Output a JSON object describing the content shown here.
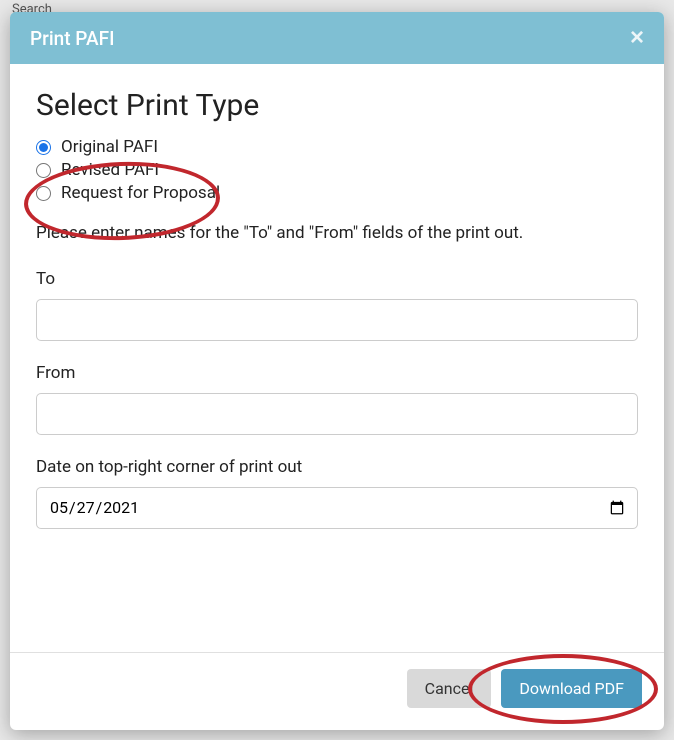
{
  "background": {
    "search_placeholder": "Search"
  },
  "modal": {
    "title": "Print PAFI",
    "section_title": "Select Print Type",
    "radios": {
      "original": "Original PAFI",
      "revised": "Revised PAFI",
      "rfp": "Request for Proposal"
    },
    "instruction": "Please enter names for the \"To\" and \"From\" fields of the print out.",
    "to_label": "To",
    "to_value": "",
    "from_label": "From",
    "from_value": "",
    "date_label": "Date on top-right corner of print out",
    "date_value": "2021-05-27",
    "date_display": "05/27/2021",
    "cancel_label": "Cancel",
    "download_label": "Download PDF"
  }
}
